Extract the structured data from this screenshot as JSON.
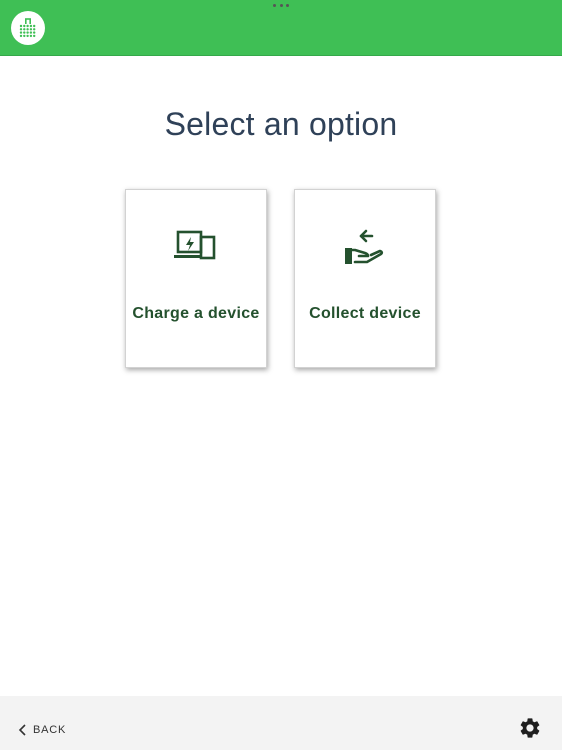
{
  "header": {
    "logo_icon": "shopping-bag-icon",
    "more_icon": "more-dots-icon",
    "background": "#3fbf55"
  },
  "main": {
    "title": "Select an option",
    "options": [
      {
        "label": "Charge a device",
        "icon": "device-charging-icon"
      },
      {
        "label": "Collect device",
        "icon": "hand-collect-icon"
      }
    ],
    "accent": "#24512e"
  },
  "footer": {
    "back_label": "BACK",
    "back_icon": "chevron-left-icon",
    "settings_icon": "gear-icon"
  }
}
